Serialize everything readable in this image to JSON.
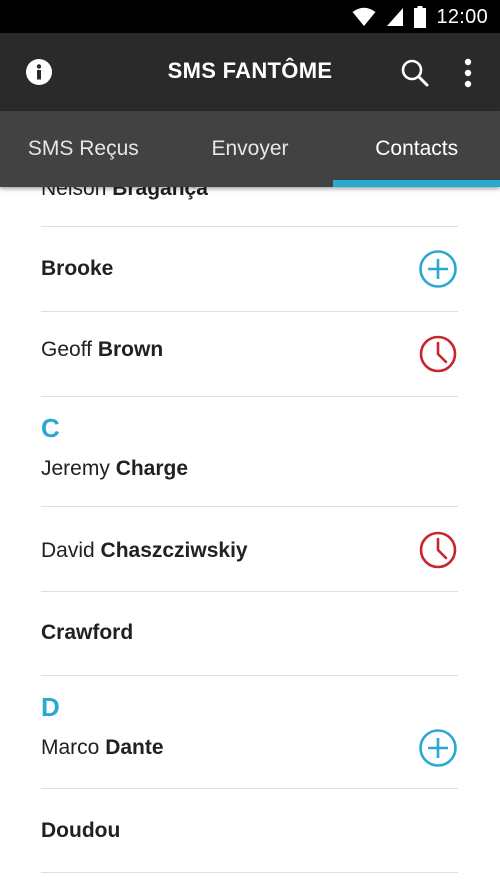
{
  "status_bar": {
    "time": "12:00"
  },
  "app_bar": {
    "title": "SMS FANTÔME"
  },
  "tabs": [
    {
      "label": "SMS Reçus",
      "active": false
    },
    {
      "label": "Envoyer",
      "active": false
    },
    {
      "label": "Contacts",
      "active": true
    }
  ],
  "colors": {
    "accent": "#29a8d2",
    "alert": "#c9252c",
    "app_bar": "#2a2a2a",
    "tab_bar": "#424242"
  },
  "contacts": [
    {
      "first": "Nelson ",
      "last": "Bragança",
      "section": "",
      "action": ""
    },
    {
      "first": "",
      "last": "Brooke",
      "section": "",
      "action": "add-icon"
    },
    {
      "first": "Geoff ",
      "last": "Brown",
      "section": "",
      "action": "clock-icon"
    },
    {
      "first": "Jeremy ",
      "last": "Charge",
      "section": "C",
      "action": ""
    },
    {
      "first": "David ",
      "last": "Chaszcziwskiy",
      "section": "",
      "action": "clock-icon"
    },
    {
      "first": "",
      "last": "Crawford",
      "section": "",
      "action": ""
    },
    {
      "first": "Marco ",
      "last": "Dante",
      "section": "D",
      "action": "add-icon"
    },
    {
      "first": "",
      "last": "Doudou",
      "section": "",
      "action": ""
    }
  ]
}
